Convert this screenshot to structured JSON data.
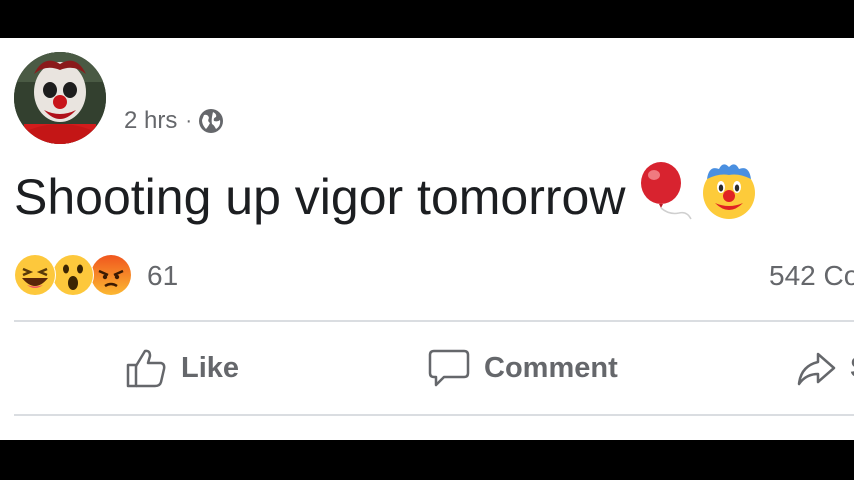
{
  "post": {
    "time": "2 hrs",
    "separator": "·",
    "privacy_icon": "globe-icon",
    "text": "Shooting up vigor tomorrow",
    "text_emojis": [
      "balloon",
      "clown-face"
    ],
    "reactions": [
      "haha",
      "wow",
      "angry"
    ],
    "reaction_count": "61",
    "comment_count": "542 Co"
  },
  "actions": {
    "like": "Like",
    "comment": "Comment",
    "share": "S"
  },
  "colors": {
    "background": "#000000",
    "card": "#ffffff",
    "text": "#1c1e21",
    "secondary_text": "#65676b",
    "divider": "#dadde1"
  }
}
